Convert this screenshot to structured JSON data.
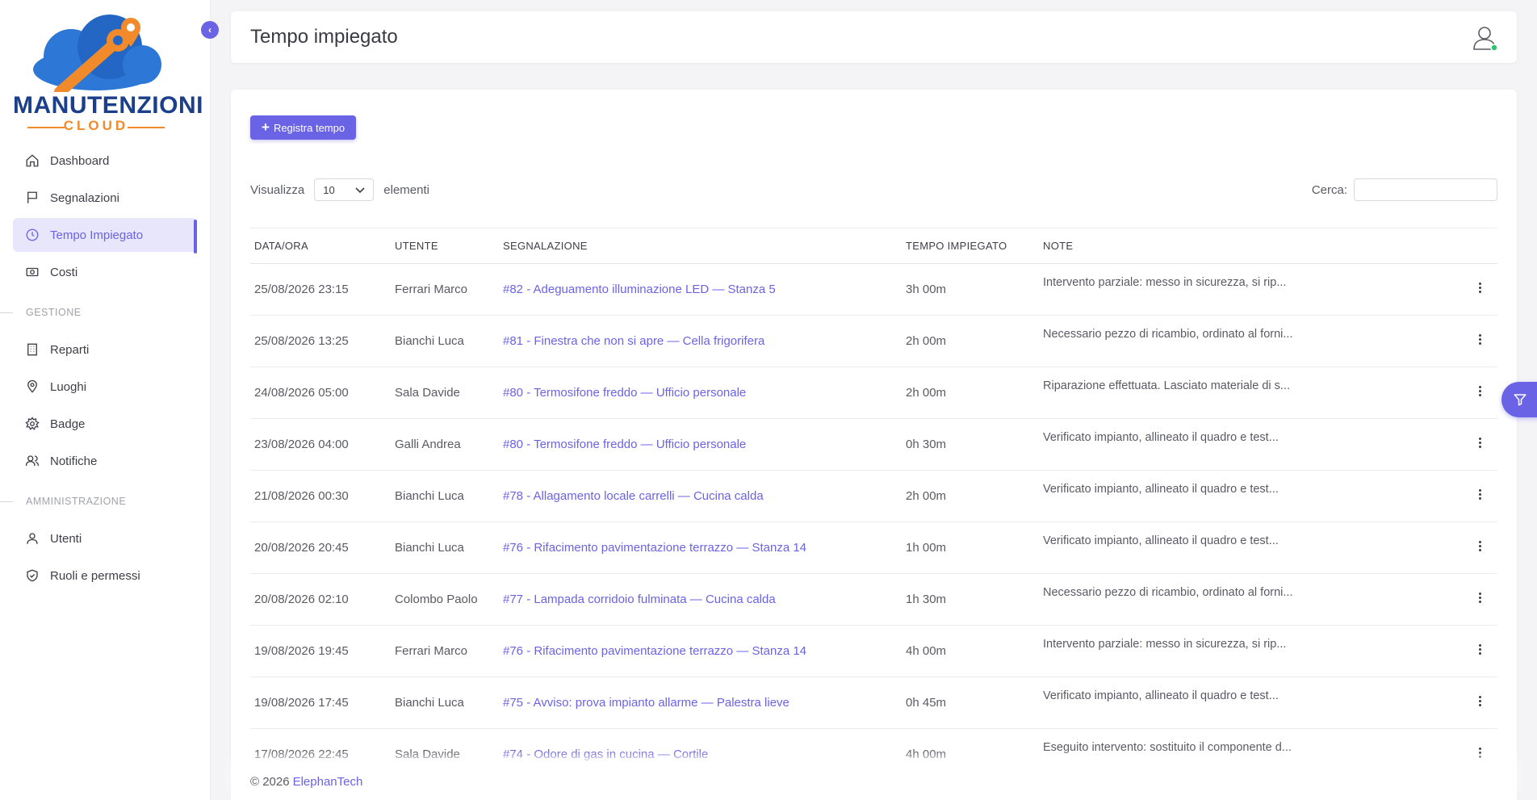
{
  "brand": {
    "title": "MANUTENZIONI",
    "subtitle": "CLOUD"
  },
  "sidebar": {
    "items_main": [
      {
        "label": "Dashboard",
        "icon": "home-icon"
      },
      {
        "label": "Segnalazioni",
        "icon": "flag-icon"
      },
      {
        "label": "Tempo Impiegato",
        "icon": "clock-icon",
        "active": true
      },
      {
        "label": "Costi",
        "icon": "money-icon"
      }
    ],
    "section_gestione": "GESTIONE",
    "items_gestione": [
      {
        "label": "Reparti",
        "icon": "building-icon"
      },
      {
        "label": "Luoghi",
        "icon": "map-pin-icon"
      },
      {
        "label": "Badge",
        "icon": "badge-gear-icon"
      },
      {
        "label": "Notifiche",
        "icon": "users-icon"
      }
    ],
    "section_admin": "AMMINISTRAZIONE",
    "items_admin": [
      {
        "label": "Utenti",
        "icon": "user-icon"
      },
      {
        "label": "Ruoli e permessi",
        "icon": "shield-check-icon"
      }
    ]
  },
  "header": {
    "title": "Tempo impiegato"
  },
  "toolbar": {
    "add_label": "Registra tempo"
  },
  "table_controls": {
    "show_label": "Visualizza",
    "page_size": "10",
    "items_label": "elementi",
    "search_label": "Cerca:"
  },
  "table": {
    "headers": [
      "DATA/ORA",
      "UTENTE",
      "SEGNALAZIONE",
      "TEMPO IMPIEGATO",
      "NOTE"
    ],
    "rows": [
      [
        "25/08/2026 23:15",
        "Ferrari Marco",
        "#82 - Adeguamento illuminazione LED — Stanza 5",
        "3h 00m",
        "Intervento parziale: messo in sicurezza, si rip..."
      ],
      [
        "25/08/2026 13:25",
        "Bianchi Luca",
        "#81 - Finestra che non si apre — Cella frigorifera",
        "2h 00m",
        "Necessario pezzo di ricambio, ordinato al forni..."
      ],
      [
        "24/08/2026 05:00",
        "Sala Davide",
        "#80 - Termosifone freddo — Ufficio personale",
        "2h 00m",
        "Riparazione effettuata. Lasciato materiale di s..."
      ],
      [
        "23/08/2026 04:00",
        "Galli Andrea",
        "#80 - Termosifone freddo — Ufficio personale",
        "0h 30m",
        "Verificato impianto, allineato il quadro e test..."
      ],
      [
        "21/08/2026 00:30",
        "Bianchi Luca",
        "#78 - Allagamento locale carrelli — Cucina calda",
        "2h 00m",
        "Verificato impianto, allineato il quadro e test..."
      ],
      [
        "20/08/2026 20:45",
        "Bianchi Luca",
        "#76 - Rifacimento pavimentazione terrazzo — Stanza 14",
        "1h 00m",
        "Verificato impianto, allineato il quadro e test..."
      ],
      [
        "20/08/2026 02:10",
        "Colombo Paolo",
        "#77 - Lampada corridoio fulminata — Cucina calda",
        "1h 30m",
        "Necessario pezzo di ricambio, ordinato al forni..."
      ],
      [
        "19/08/2026 19:45",
        "Ferrari Marco",
        "#76 - Rifacimento pavimentazione terrazzo — Stanza 14",
        "4h 00m",
        "Intervento parziale: messo in sicurezza, si rip..."
      ],
      [
        "19/08/2026 17:45",
        "Bianchi Luca",
        "#75 - Avviso: prova impianto allarme — Palestra lieve",
        "0h 45m",
        "Verificato impianto, allineato il quadro e test..."
      ],
      [
        "17/08/2026 22:45",
        "Sala Davide",
        "#74 - Odore di gas in cucina — Cortile",
        "4h 00m",
        "Eseguito intervento: sostituito il componente d..."
      ]
    ]
  },
  "footer": {
    "copyright": "© 2026",
    "company": "ElephanTech"
  },
  "colors": {
    "accent": "#6b63e6",
    "brand_blue": "#1b3f8a",
    "brand_orange": "#f08a2a"
  }
}
